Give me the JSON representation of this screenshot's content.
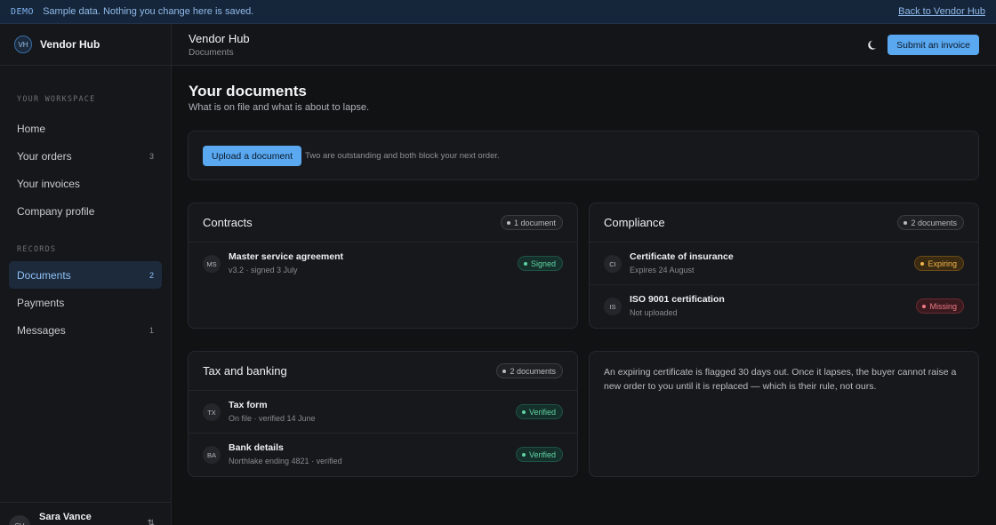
{
  "banner": {
    "tag": "DEMO",
    "message": "Sample data. Nothing you change here is saved.",
    "back_link": "Back to Vendor Hub"
  },
  "sidebar": {
    "brand_initials": "VH",
    "brand_name": "Vendor Hub",
    "workspace_label": "YOUR WORKSPACE",
    "workspace_items": [
      {
        "label": "Home",
        "count": ""
      },
      {
        "label": "Your orders",
        "count": "3"
      },
      {
        "label": "Your invoices",
        "count": ""
      },
      {
        "label": "Company profile",
        "count": ""
      }
    ],
    "records_label": "RECORDS",
    "records_items": [
      {
        "label": "Documents",
        "count": "2",
        "active": true
      },
      {
        "label": "Payments",
        "count": ""
      },
      {
        "label": "Messages",
        "count": "1"
      }
    ],
    "user": {
      "initials": "SV",
      "name": "Sara Vance",
      "switch_glyph": "⇅"
    }
  },
  "topbar": {
    "title": "Vendor Hub",
    "subtitle": "Documents",
    "theme_icon": "moon-icon",
    "submit_label": "Submit an invoice"
  },
  "main": {
    "title": "Your documents",
    "description": "What is on file and what is about to lapse.",
    "upload": {
      "button_label": "Upload a document",
      "note": "Two are outstanding and both block your next order."
    },
    "groups": [
      {
        "title": "Contracts",
        "count_label": "1 document",
        "docs": [
          {
            "initials": "MS",
            "name": "Master service agreement",
            "meta": "v3.2 · signed 3 July",
            "status": "Signed",
            "tone": "green"
          }
        ]
      },
      {
        "title": "Compliance",
        "count_label": "2 documents",
        "docs": [
          {
            "initials": "CI",
            "name": "Certificate of insurance",
            "meta": "Expires 24 August",
            "status": "Expiring",
            "tone": "amber"
          },
          {
            "initials": "IS",
            "name": "ISO 9001 certification",
            "meta": "Not uploaded",
            "status": "Missing",
            "tone": "red"
          }
        ]
      },
      {
        "title": "Tax and banking",
        "count_label": "2 documents",
        "docs": [
          {
            "initials": "TX",
            "name": "Tax form",
            "meta": "On file · verified 14 June",
            "status": "Verified",
            "tone": "green"
          },
          {
            "initials": "BA",
            "name": "Bank details",
            "meta": "Northlake ending 4821 · verified",
            "status": "Verified",
            "tone": "green"
          }
        ]
      }
    ],
    "info": "An expiring certificate is flagged 30 days out. Once it lapses, the buyer cannot raise a new order to you until it is replaced — which is their rule, not ours."
  },
  "colors": {
    "accent": "#5aa8f0",
    "background": "#111214",
    "status_green": "#5fd3a3",
    "status_amber": "#f0b549",
    "status_red": "#f07a86"
  }
}
